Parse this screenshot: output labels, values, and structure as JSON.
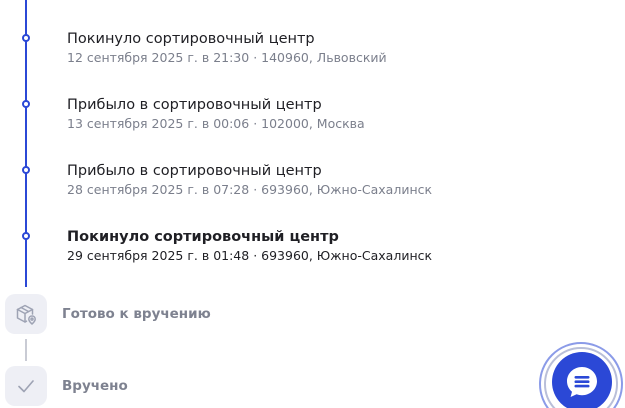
{
  "timeline": {
    "events": [
      {
        "title": "Покинуло сортировочный центр",
        "details": "12 сентября 2025 г. в 21:30 · 140960, Львовский"
      },
      {
        "title": "Прибыло в сортировочный центр",
        "details": "13 сентября 2025 г. в 00:06 · 102000, Москва"
      },
      {
        "title": "Прибыло в сортировочный центр",
        "details": "28 сентября 2025 г. в 07:28 · 693960, Южно-Сахалинск"
      },
      {
        "title": "Покинуло сортировочный центр",
        "details": "29 сентября 2025 г. в 01:48 · 693960, Южно-Сахалинск"
      }
    ],
    "stages": [
      {
        "label": "Готово к вручению",
        "icon": "parcel-pickup-icon"
      },
      {
        "label": "Вручено",
        "icon": "checkmark-icon"
      }
    ]
  },
  "colors": {
    "accent": "#2b48d6",
    "text_primary": "#1f1f24",
    "text_secondary": "#7b7f8c",
    "stage_bg": "#eeeff5"
  },
  "chat": {
    "icon": "chat-icon"
  }
}
